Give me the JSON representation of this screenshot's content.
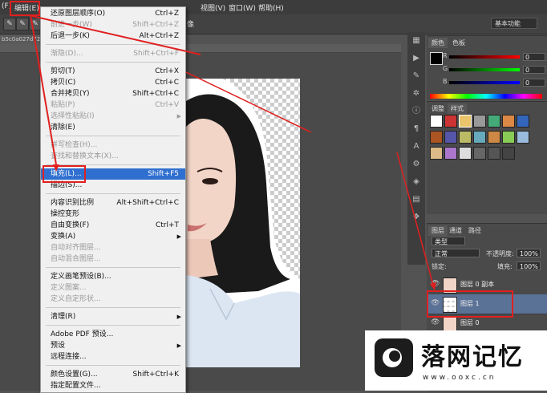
{
  "menubar": {
    "items": [
      "(F)",
      "编辑(E)",
      "视图(V)",
      "窗口(W)",
      "帮助(H)"
    ]
  },
  "optionsbar": {
    "preset": "基本功能",
    "partial_label": "像"
  },
  "document": {
    "tab_label": "b5c0a027d727"
  },
  "edit_menu": {
    "items": [
      {
        "label": "还原图层顺序(O)",
        "shortcut": "Ctrl+Z",
        "disabled": false
      },
      {
        "label": "前进一步(W)",
        "shortcut": "Shift+Ctrl+Z",
        "disabled": true
      },
      {
        "label": "后退一步(K)",
        "shortcut": "Alt+Ctrl+Z",
        "disabled": false
      },
      {
        "label": "渐隐(D)...",
        "shortcut": "Shift+Ctrl+F",
        "disabled": true
      },
      {
        "label": "剪切(T)",
        "shortcut": "Ctrl+X",
        "disabled": false
      },
      {
        "label": "拷贝(C)",
        "shortcut": "Ctrl+C",
        "disabled": false
      },
      {
        "label": "合并拷贝(Y)",
        "shortcut": "Shift+Ctrl+C",
        "disabled": false
      },
      {
        "label": "粘贴(P)",
        "shortcut": "Ctrl+V",
        "disabled": true
      },
      {
        "label": "选择性粘贴(I)",
        "shortcut": "",
        "disabled": true
      },
      {
        "label": "清除(E)",
        "shortcut": "",
        "disabled": false
      },
      {
        "label": "拼写检查(H)...",
        "shortcut": "",
        "disabled": true
      },
      {
        "label": "查找和替换文本(X)...",
        "shortcut": "",
        "disabled": true
      },
      {
        "label": "填充(L)...",
        "shortcut": "Shift+F5",
        "disabled": false
      },
      {
        "label": "描边(S)...",
        "shortcut": "",
        "disabled": false
      },
      {
        "label": "内容识别比例",
        "shortcut": "Alt+Shift+Ctrl+C",
        "disabled": false
      },
      {
        "label": "操控变形",
        "shortcut": "",
        "disabled": false
      },
      {
        "label": "自由变换(F)",
        "shortcut": "Ctrl+T",
        "disabled": false
      },
      {
        "label": "变换(A)",
        "shortcut": "",
        "disabled": false
      },
      {
        "label": "自动对齐图层...",
        "shortcut": "",
        "disabled": true
      },
      {
        "label": "自动混合图层...",
        "shortcut": "",
        "disabled": true
      },
      {
        "label": "定义画笔预设(B)...",
        "shortcut": "",
        "disabled": false
      },
      {
        "label": "定义图案...",
        "shortcut": "",
        "disabled": true
      },
      {
        "label": "定义自定形状...",
        "shortcut": "",
        "disabled": true
      },
      {
        "label": "清理(R)",
        "shortcut": "",
        "disabled": false
      },
      {
        "label": "Adobe PDF 预设...",
        "shortcut": "",
        "disabled": false
      },
      {
        "label": "预设",
        "shortcut": "",
        "disabled": false
      },
      {
        "label": "远程连接...",
        "shortcut": "",
        "disabled": false
      },
      {
        "label": "颜色设置(G)...",
        "shortcut": "Shift+Ctrl+K",
        "disabled": false
      },
      {
        "label": "指定配置文件...",
        "shortcut": "",
        "disabled": false
      }
    ]
  },
  "color_panel": {
    "tabs": [
      "颜色",
      "色板"
    ],
    "channels": [
      {
        "name": "R",
        "value": "0"
      },
      {
        "name": "G",
        "value": "0"
      },
      {
        "name": "B",
        "value": "0"
      }
    ]
  },
  "styles_panel": {
    "tabs": [
      "调整",
      "样式"
    ]
  },
  "layers_panel": {
    "tabs": [
      "图层",
      "通道",
      "路径"
    ],
    "filter": "类型",
    "blend_mode": "正常",
    "opacity_label": "不透明度:",
    "opacity": "100%",
    "lock_label": "锁定:",
    "fill_label": "填充:",
    "fill": "100%",
    "layers": [
      "图层 0 副本",
      "图层 1",
      "图层 0"
    ]
  },
  "watermark": {
    "title": "落网记忆",
    "url": "www.ooxc.cn"
  }
}
